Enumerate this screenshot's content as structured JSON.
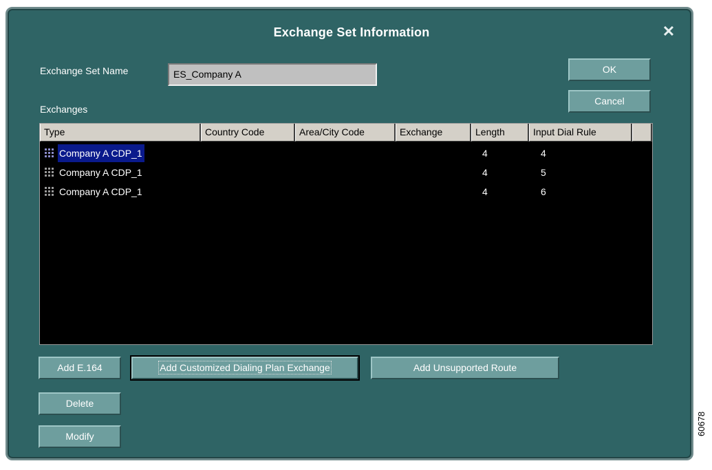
{
  "window": {
    "title": "Exchange Set Information"
  },
  "form": {
    "name_label": "Exchange Set Name",
    "name_value": "ES_Company A",
    "exchanges_label": "Exchanges"
  },
  "buttons": {
    "ok": "OK",
    "cancel": "Cancel",
    "add_e164": "Add E.164",
    "add_cdp": "Add Customized Dialing Plan Exchange",
    "add_unsupported": "Add Unsupported Route",
    "delete": "Delete",
    "modify": "Modify"
  },
  "table": {
    "columns": [
      "Type",
      "Country Code",
      "Area/City Code",
      "Exchange",
      "Length",
      "Input Dial Rule"
    ],
    "rows": [
      {
        "type": "Company A CDP_1",
        "country_code": "",
        "area_city_code": "",
        "exchange": "",
        "length": "4",
        "input_dial_rule": "4",
        "selected": true
      },
      {
        "type": "Company A CDP_1",
        "country_code": "",
        "area_city_code": "",
        "exchange": "",
        "length": "4",
        "input_dial_rule": "5",
        "selected": false
      },
      {
        "type": "Company A CDP_1",
        "country_code": "",
        "area_city_code": "",
        "exchange": "",
        "length": "4",
        "input_dial_rule": "6",
        "selected": false
      }
    ],
    "row_icon": "grid-keypad-icon"
  },
  "figure_id": "60678",
  "colors": {
    "window_bg": "#2f6465",
    "button_bg": "#6e9e9e",
    "table_bg": "#000000",
    "selection": "#0a1a8c"
  }
}
